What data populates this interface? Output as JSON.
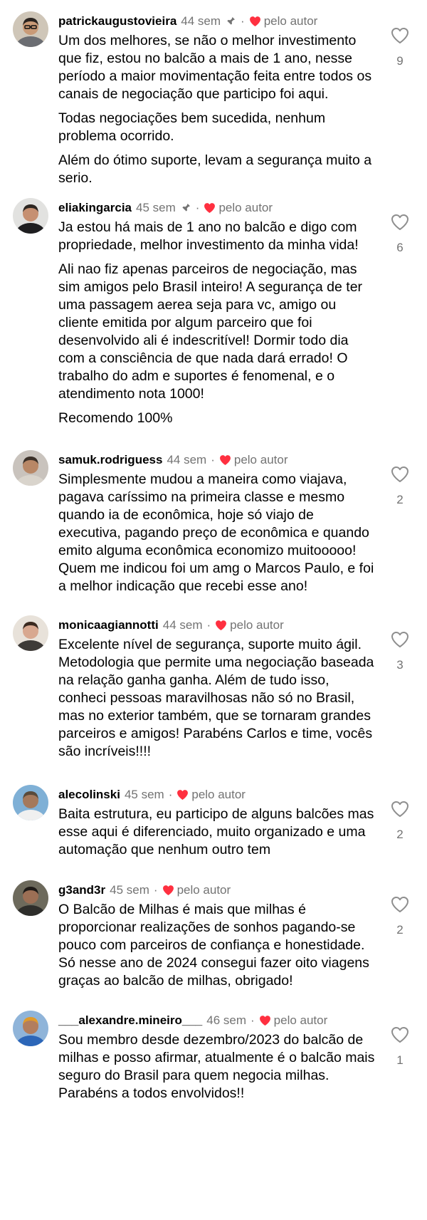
{
  "common": {
    "by_author_label": "pelo autor",
    "dot": "·"
  },
  "comments": [
    {
      "username": "patrickaugustovieira",
      "time": "44 sem",
      "pinned": true,
      "paragraphs": [
        "Um dos melhores, se não o melhor investimento que fiz, estou no balcão a mais de 1 ano, nesse período a maior movimentação feita entre todos os canais de negociação que participo foi aqui.",
        "Todas negociações bem sucedida, nenhum problema ocorrido.",
        "Além do ótimo suporte, levam a segurança muito a serio."
      ],
      "likes": "9"
    },
    {
      "username": "eliakingarcia",
      "time": "45 sem",
      "pinned": true,
      "paragraphs": [
        "Ja estou há mais de 1 ano no balcão e digo com propriedade, melhor investimento da minha vida!",
        "Ali nao fiz apenas parceiros de negociação, mas sim amigos pelo Brasil inteiro! A segurança de ter uma passagem aerea seja para vc, amigo ou cliente emitida por algum parceiro que foi desenvolvido ali é indescritível! Dormir todo dia com a consciência de que nada dará errado! O trabalho do adm e suportes é fenomenal, e o atendimento nota 1000!",
        "Recomendo 100%"
      ],
      "likes": "6"
    },
    {
      "username": "samuk.rodriguess",
      "time": "44 sem",
      "pinned": false,
      "paragraphs": [
        "Simplesmente mudou a maneira como viajava, pagava caríssimo na primeira classe e mesmo quando ia de econômica, hoje só viajo de executiva, pagando preço de econômica e quando emito alguma econômica economizo muitooooo! Quem me indicou foi um amg o Marcos Paulo, e foi a melhor indicação que recebi esse ano!"
      ],
      "likes": "2"
    },
    {
      "username": "monicaagiannotti",
      "time": "44 sem",
      "pinned": false,
      "paragraphs": [
        "Excelente nível de segurança, suporte muito ágil. Metodologia que permite uma negociação baseada na relação ganha ganha. Além de tudo isso, conheci pessoas maravilhosas não só no Brasil, mas no exterior também, que se tornaram grandes parceiros e amigos!  Parabéns Carlos e time, vocês são incríveis!!!!"
      ],
      "likes": "3"
    },
    {
      "username": "alecolinski",
      "time": "45 sem",
      "pinned": false,
      "paragraphs": [
        "Baita estrutura, eu participo de alguns balcões mas esse aqui é diferenciado, muito organizado e uma automação que nenhum outro tem"
      ],
      "likes": "2"
    },
    {
      "username": "g3and3r",
      "time": "45 sem",
      "pinned": false,
      "paragraphs": [
        "O Balcão de Milhas é mais que milhas é proporcionar realizações de sonhos pagando-se pouco com parceiros de confiança e honestidade. Só nesse ano de 2024 consegui fazer oito viagens graças ao balcão de milhas, obrigado!"
      ],
      "likes": "2"
    },
    {
      "username": "___alexandre.mineiro___",
      "time": "46 sem",
      "pinned": false,
      "paragraphs": [
        "Sou membro desde dezembro/2023 do balcão de milhas e posso afirmar, atualmente é o balcão mais seguro do Brasil para quem negocia milhas. Parabéns a todos envolvidos!!"
      ],
      "likes": "1"
    }
  ],
  "colors": {
    "heart": "#ff3040",
    "meta_gray": "#737373",
    "text": "#000000"
  },
  "icons": {
    "pin": "pin-icon",
    "author_heart": "heart-filled-icon",
    "like": "heart-outline-icon"
  }
}
